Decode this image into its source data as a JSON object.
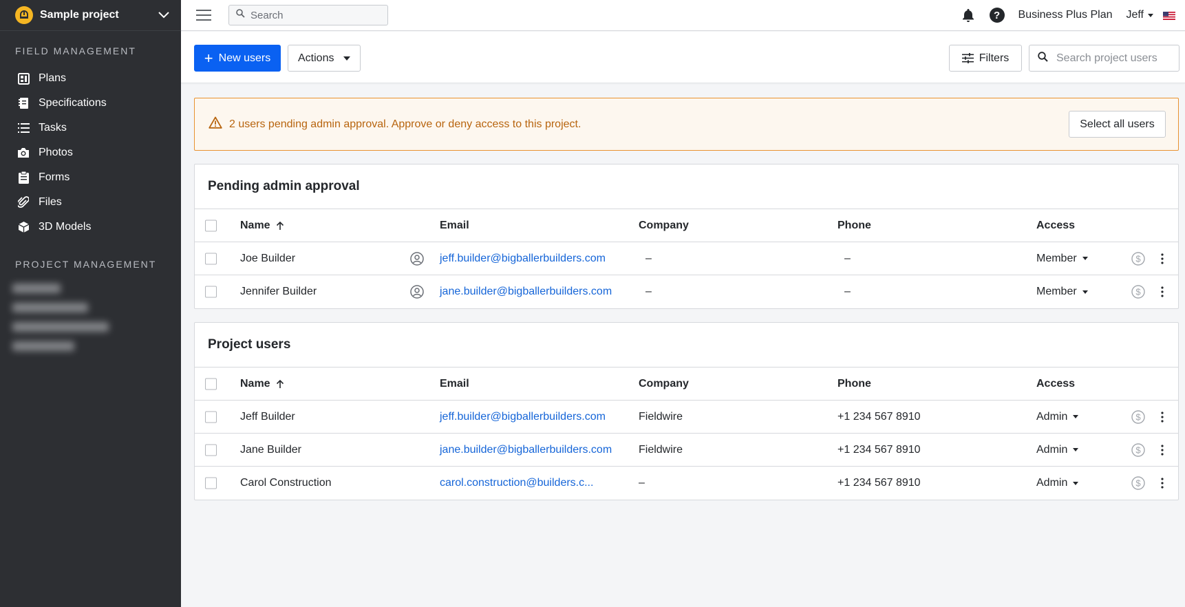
{
  "sidebar": {
    "project_name": "Sample project",
    "field_management_label": "FIELD MANAGEMENT",
    "field_items": [
      {
        "label": "Plans"
      },
      {
        "label": "Specifications"
      },
      {
        "label": "Tasks"
      },
      {
        "label": "Photos"
      },
      {
        "label": "Forms"
      },
      {
        "label": "Files"
      },
      {
        "label": "3D Models"
      }
    ],
    "project_management_label": "PROJECT MANAGEMENT"
  },
  "topbar": {
    "search_placeholder": "Search",
    "plan_label": "Business Plus Plan",
    "user_name": "Jeff"
  },
  "toolbar": {
    "new_users_label": "New users",
    "actions_label": "Actions",
    "filters_label": "Filters",
    "search_users_placeholder": "Search project users"
  },
  "banner": {
    "message": "2 users pending admin approval. Approve or deny access to this project.",
    "select_all_label": "Select all users"
  },
  "columns": {
    "name": "Name",
    "email": "Email",
    "company": "Company",
    "phone": "Phone",
    "access": "Access"
  },
  "pending": {
    "title": "Pending admin approval",
    "rows": [
      {
        "name": "Joe Builder",
        "email": "jeff.builder@bigballerbuilders.com",
        "company": "–",
        "phone": "–",
        "access": "Member"
      },
      {
        "name": "Jennifer Builder",
        "email": "jane.builder@bigballerbuilders.com",
        "company": "–",
        "phone": "–",
        "access": "Member"
      }
    ]
  },
  "project_users": {
    "title": "Project users",
    "rows": [
      {
        "name": "Jeff Builder",
        "email": "jeff.builder@bigballerbuilders.com",
        "company": "Fieldwire",
        "phone": "+1 234 567 8910",
        "access": "Admin"
      },
      {
        "name": "Jane Builder",
        "email": "jane.builder@bigballerbuilders.com",
        "company": "Fieldwire",
        "phone": "+1 234 567 8910",
        "access": "Admin"
      },
      {
        "name": "Carol Construction",
        "email": "carol.construction@builders.c...",
        "company": "–",
        "phone": "+1 234 567 8910",
        "access": "Admin"
      }
    ]
  },
  "colors": {
    "primary": "#0a61f2",
    "link": "#1565d8",
    "warning_text": "#b8650f",
    "warning_border": "#e8912f",
    "sidebar_bg": "#2d2f33"
  }
}
